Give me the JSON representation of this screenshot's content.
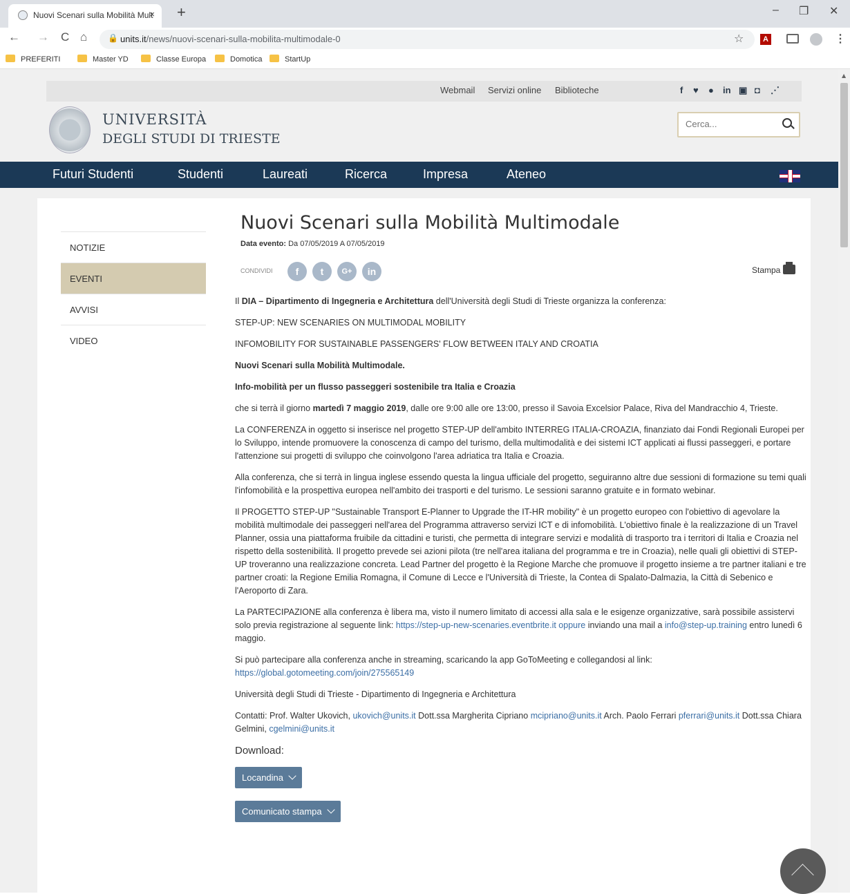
{
  "browser": {
    "tab_title": "Nuovi Scenari sulla Mobilità Mult",
    "tab_close": "×",
    "new_tab": "+",
    "win_min": "–",
    "win_max": "❐",
    "win_close": "✕",
    "back": "←",
    "forward": "→",
    "reload": "C",
    "home": "⌂",
    "url_domain": "units.it",
    "url_path": "/news/nuovi-scenari-sulla-mobilita-multimodale-0",
    "bookmarks": [
      "PREFERITI",
      "Master YD",
      "Classe Europa",
      "Domotica",
      "StartUp"
    ]
  },
  "topbar": {
    "links": [
      "Webmail",
      "Servizi online",
      "Biblioteche"
    ],
    "social_icons": [
      "facebook-icon",
      "twitter-icon",
      "apple-icon",
      "linkedin-icon",
      "youtube-icon",
      "instagram-icon",
      "rss-icon"
    ],
    "social_glyphs": [
      "f",
      "🐦",
      "",
      "in",
      "▣",
      "◘",
      "⋰"
    ]
  },
  "header": {
    "uni_line1": "UNIVERSITÀ",
    "uni_line2": "DEGLI STUDI DI TRIESTE",
    "search_placeholder": "Cerca..."
  },
  "mainnav": [
    "Futuri Studenti",
    "Studenti",
    "Laureati",
    "Ricerca",
    "Impresa",
    "Ateneo"
  ],
  "sidebar": [
    "NOTIZIE",
    "EVENTI",
    "AVVISI",
    "VIDEO"
  ],
  "article": {
    "title": "Nuovi Scenari sulla Mobilità Multimodale",
    "date_label": "Data evento:",
    "date_value": " Da  07/05/2019 A  07/05/2019",
    "share_label": "CONDIVIDI",
    "share_buttons": [
      "f",
      "t",
      "G+",
      "in"
    ],
    "print_label": "Stampa",
    "p1_a": "Il ",
    "p1_b": "DIA – Dipartimento di Ingegneria e Architettura",
    "p1_c": " dell'Università degli Studi di Trieste organizza la conferenza:",
    "h1": "STEP-UP: NEW SCENARIES ON MULTIMODAL MOBILITY",
    "h2": "INFOMOBILITY FOR SUSTAINABLE PASSENGERS' FLOW BETWEEN ITALY AND CROATIA",
    "h3": "Nuovi Scenari sulla Mobilità Multimodale.",
    "h4": "Info-mobilità per un flusso passeggeri sostenibile tra Italia e Croazia",
    "p2_a": "che si terrà il giorno ",
    "p2_b": "martedì 7 maggio 2019",
    "p2_c": ", dalle ore 9:00 alle ore 13:00, presso il Savoia Excelsior Palace, Riva del Mandracchio 4, Trieste.",
    "p3": "La CONFERENZA in oggetto si inserisce nel progetto STEP-UP dell'ambito INTERREG ITALIA-CROAZIA, finanziato dai Fondi Regionali Europei per lo Sviluppo, intende promuovere la conoscenza di campo del turismo, della multimodalità e dei sistemi ICT applicati ai flussi passeggeri, e portare l'attenzione sui progetti di sviluppo che coinvolgono l'area adriatica tra Italia e Croazia.",
    "p4": "Alla conferenza, che si terrà in lingua inglese essendo questa la lingua ufficiale del progetto, seguiranno altre due sessioni di formazione su temi quali l'infomobilità e la prospettiva europea nell'ambito dei trasporti e del turismo. Le sessioni saranno gratuite e in formato webinar.",
    "p5": "Il PROGETTO STEP-UP \"Sustainable Transport E-Planner to Upgrade the IT-HR mobility\" è un progetto europeo con l'obiettivo di agevolare la mobilità multimodale dei passeggeri nell'area del Programma attraverso servizi ICT e di infomobilità. L'obiettivo finale è la realizzazione di un Travel Planner, ossia una piattaforma fruibile da cittadini e turisti, che permetta di integrare servizi e modalità di trasporto tra i territori di Italia e Croazia nel rispetto della sostenibilità. Il progetto prevede sei azioni pilota (tre nell'area italiana del programma e tre in Croazia), nelle quali gli obiettivi di STEP-UP troveranno una realizzazione concreta. Lead Partner del progetto è la Regione Marche che promuove il progetto insieme a tre partner italiani e tre partner croati: la Regione Emilia Romagna, il Comune di Lecce e l'Università di Trieste, la Contea di Spalato-Dalmazia, la Città di Sebenico e l'Aeroporto di Zara.",
    "p6_a": "La PARTECIPAZIONE alla conferenza è libera ma, visto il numero limitato di accessi alla sala e le esigenze organizzative, sarà possibile assistervi solo previa registrazione al seguente link: ",
    "p6_link1": "https://step-up-new-scenaries.eventbrite.it oppure",
    "p6_b": " inviando una mail a ",
    "p6_link2": "info@step-up.training",
    "p6_c": " entro lunedì 6 maggio.",
    "p7_a": "Si può partecipare alla conferenza anche in streaming, scaricando la app GoToMeeting e collegandosi al link: ",
    "p7_link": "https://global.gotomeeting.com/join/275565149",
    "p8": "Università degli Studi di Trieste - Dipartimento di Ingegneria e Architettura",
    "p9_a": "Contatti: Prof. Walter Ukovich, ",
    "p9_l1": "ukovich@units.it",
    "p9_b": " Dott.ssa Margherita Cipriano ",
    "p9_l2": "mcipriano@units.it",
    "p9_c": " Arch. Paolo Ferrari ",
    "p9_l3": "pferrari@units.it",
    "p9_d": " Dott.ssa Chiara Gelmini, ",
    "p9_l4": "cgelmini@units.it",
    "download_label": "Download:",
    "downloads": [
      "Locandina",
      "Comunicato stampa"
    ]
  }
}
